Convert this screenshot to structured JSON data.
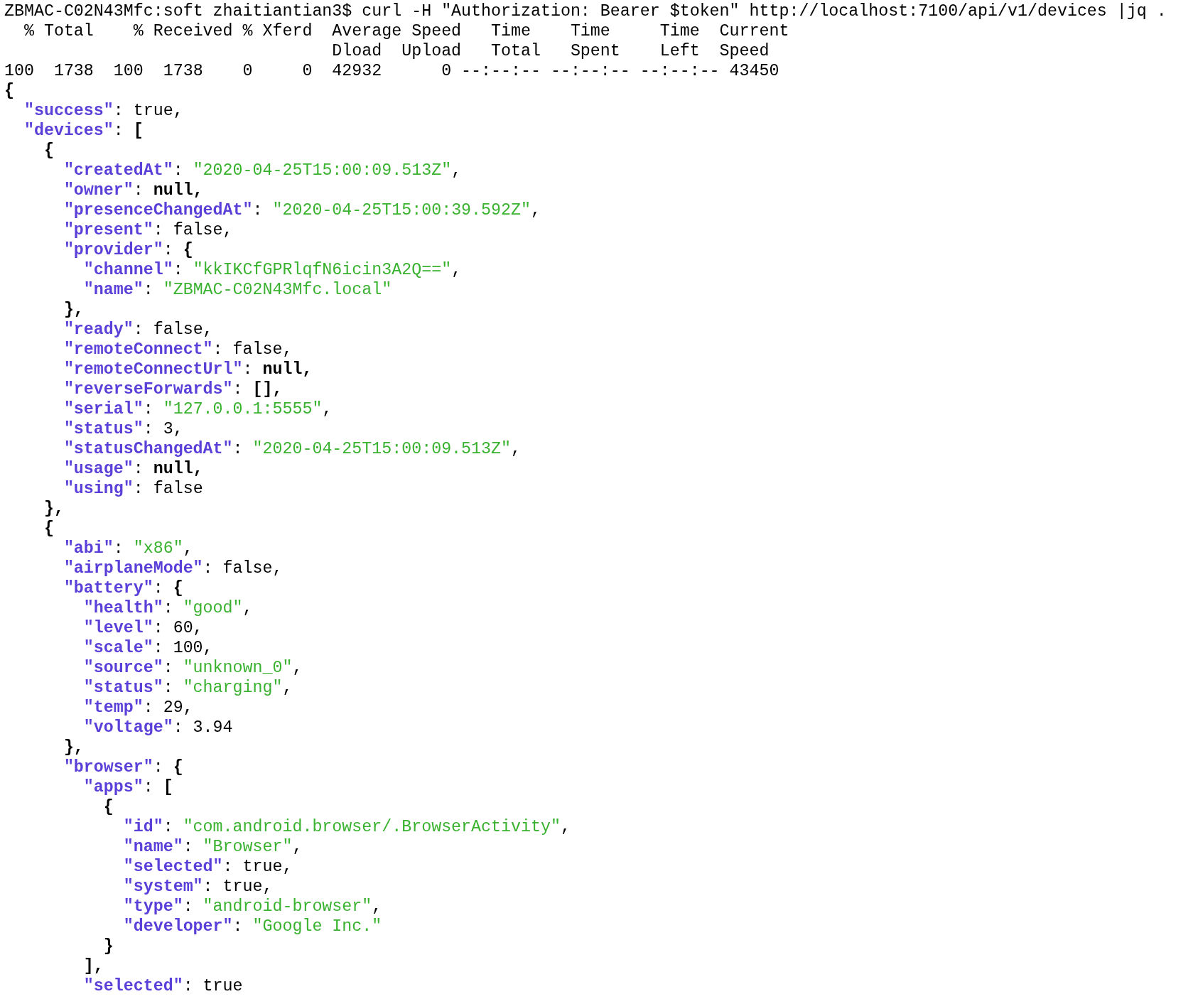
{
  "prompt": {
    "text": "ZBMAC-C02N43Mfc:soft zhaitiantian3$ curl -H \"Authorization: Bearer $token\" http://localhost:7100/api/v1/devices |jq ."
  },
  "curl_output": [
    "  % Total    % Received % Xferd  Average Speed   Time    Time     Time  Current",
    "                                 Dload  Upload   Total   Spent    Left  Speed",
    "100  1738  100  1738    0     0  42932      0 --:--:-- --:--:-- --:--:-- 43450"
  ],
  "json_output": [
    {
      "tokens": [
        {
          "kind": "bold",
          "text": "{"
        }
      ],
      "children": [
        {
          "tokens": [
            {
              "kind": "key",
              "text": "\"success\""
            },
            {
              "kind": "plain",
              "text": ": true,"
            }
          ]
        },
        {
          "tokens": [
            {
              "kind": "key",
              "text": "\"devices\""
            },
            {
              "kind": "plain",
              "text": ": "
            },
            {
              "kind": "bold",
              "text": "["
            }
          ],
          "children": [
            {
              "tokens": [
                {
                  "kind": "bold",
                  "text": "{"
                }
              ],
              "children": [
                {
                  "tokens": [
                    {
                      "kind": "key",
                      "text": "\"createdAt\""
                    },
                    {
                      "kind": "plain",
                      "text": ": "
                    },
                    {
                      "kind": "string",
                      "text": "\"2020-04-25T15:00:09.513Z\""
                    },
                    {
                      "kind": "plain",
                      "text": ","
                    }
                  ]
                },
                {
                  "tokens": [
                    {
                      "kind": "key",
                      "text": "\"owner\""
                    },
                    {
                      "kind": "plain",
                      "text": ": "
                    },
                    {
                      "kind": "bold",
                      "text": "null,"
                    }
                  ]
                },
                {
                  "tokens": [
                    {
                      "kind": "key",
                      "text": "\"presenceChangedAt\""
                    },
                    {
                      "kind": "plain",
                      "text": ": "
                    },
                    {
                      "kind": "string",
                      "text": "\"2020-04-25T15:00:39.592Z\""
                    },
                    {
                      "kind": "plain",
                      "text": ","
                    }
                  ]
                },
                {
                  "tokens": [
                    {
                      "kind": "key",
                      "text": "\"present\""
                    },
                    {
                      "kind": "plain",
                      "text": ": false,"
                    }
                  ]
                },
                {
                  "tokens": [
                    {
                      "kind": "key",
                      "text": "\"provider\""
                    },
                    {
                      "kind": "plain",
                      "text": ": "
                    },
                    {
                      "kind": "bold",
                      "text": "{"
                    }
                  ],
                  "children": [
                    {
                      "tokens": [
                        {
                          "kind": "key",
                          "text": "\"channel\""
                        },
                        {
                          "kind": "plain",
                          "text": ": "
                        },
                        {
                          "kind": "string",
                          "text": "\"kkIKCfGPRlqfN6icin3A2Q==\""
                        },
                        {
                          "kind": "plain",
                          "text": ","
                        }
                      ]
                    },
                    {
                      "tokens": [
                        {
                          "kind": "key",
                          "text": "\"name\""
                        },
                        {
                          "kind": "plain",
                          "text": ": "
                        },
                        {
                          "kind": "string",
                          "text": "\"ZBMAC-C02N43Mfc.local\""
                        }
                      ]
                    }
                  ]
                },
                {
                  "tokens": [
                    {
                      "kind": "bold",
                      "text": "},"
                    }
                  ]
                },
                {
                  "tokens": [
                    {
                      "kind": "key",
                      "text": "\"ready\""
                    },
                    {
                      "kind": "plain",
                      "text": ": false,"
                    }
                  ]
                },
                {
                  "tokens": [
                    {
                      "kind": "key",
                      "text": "\"remoteConnect\""
                    },
                    {
                      "kind": "plain",
                      "text": ": false,"
                    }
                  ]
                },
                {
                  "tokens": [
                    {
                      "kind": "key",
                      "text": "\"remoteConnectUrl\""
                    },
                    {
                      "kind": "plain",
                      "text": ": "
                    },
                    {
                      "kind": "bold",
                      "text": "null,"
                    }
                  ]
                },
                {
                  "tokens": [
                    {
                      "kind": "key",
                      "text": "\"reverseForwards\""
                    },
                    {
                      "kind": "plain",
                      "text": ": "
                    },
                    {
                      "kind": "bold",
                      "text": "[],"
                    }
                  ]
                },
                {
                  "tokens": [
                    {
                      "kind": "key",
                      "text": "\"serial\""
                    },
                    {
                      "kind": "plain",
                      "text": ": "
                    },
                    {
                      "kind": "string",
                      "text": "\"127.0.0.1:5555\""
                    },
                    {
                      "kind": "plain",
                      "text": ","
                    }
                  ]
                },
                {
                  "tokens": [
                    {
                      "kind": "key",
                      "text": "\"status\""
                    },
                    {
                      "kind": "plain",
                      "text": ": 3,"
                    }
                  ]
                },
                {
                  "tokens": [
                    {
                      "kind": "key",
                      "text": "\"statusChangedAt\""
                    },
                    {
                      "kind": "plain",
                      "text": ": "
                    },
                    {
                      "kind": "string",
                      "text": "\"2020-04-25T15:00:09.513Z\""
                    },
                    {
                      "kind": "plain",
                      "text": ","
                    }
                  ]
                },
                {
                  "tokens": [
                    {
                      "kind": "key",
                      "text": "\"usage\""
                    },
                    {
                      "kind": "plain",
                      "text": ": "
                    },
                    {
                      "kind": "bold",
                      "text": "null,"
                    }
                  ]
                },
                {
                  "tokens": [
                    {
                      "kind": "key",
                      "text": "\"using\""
                    },
                    {
                      "kind": "plain",
                      "text": ": false"
                    }
                  ]
                }
              ]
            },
            {
              "tokens": [
                {
                  "kind": "bold",
                  "text": "},"
                }
              ]
            },
            {
              "tokens": [
                {
                  "kind": "bold",
                  "text": "{"
                }
              ],
              "children": [
                {
                  "tokens": [
                    {
                      "kind": "key",
                      "text": "\"abi\""
                    },
                    {
                      "kind": "plain",
                      "text": ": "
                    },
                    {
                      "kind": "string",
                      "text": "\"x86\""
                    },
                    {
                      "kind": "plain",
                      "text": ","
                    }
                  ]
                },
                {
                  "tokens": [
                    {
                      "kind": "key",
                      "text": "\"airplaneMode\""
                    },
                    {
                      "kind": "plain",
                      "text": ": false,"
                    }
                  ]
                },
                {
                  "tokens": [
                    {
                      "kind": "key",
                      "text": "\"battery\""
                    },
                    {
                      "kind": "plain",
                      "text": ": "
                    },
                    {
                      "kind": "bold",
                      "text": "{"
                    }
                  ],
                  "children": [
                    {
                      "tokens": [
                        {
                          "kind": "key",
                          "text": "\"health\""
                        },
                        {
                          "kind": "plain",
                          "text": ": "
                        },
                        {
                          "kind": "string",
                          "text": "\"good\""
                        },
                        {
                          "kind": "plain",
                          "text": ","
                        }
                      ]
                    },
                    {
                      "tokens": [
                        {
                          "kind": "key",
                          "text": "\"level\""
                        },
                        {
                          "kind": "plain",
                          "text": ": 60,"
                        }
                      ]
                    },
                    {
                      "tokens": [
                        {
                          "kind": "key",
                          "text": "\"scale\""
                        },
                        {
                          "kind": "plain",
                          "text": ": 100,"
                        }
                      ]
                    },
                    {
                      "tokens": [
                        {
                          "kind": "key",
                          "text": "\"source\""
                        },
                        {
                          "kind": "plain",
                          "text": ": "
                        },
                        {
                          "kind": "string",
                          "text": "\"unknown_0\""
                        },
                        {
                          "kind": "plain",
                          "text": ","
                        }
                      ]
                    },
                    {
                      "tokens": [
                        {
                          "kind": "key",
                          "text": "\"status\""
                        },
                        {
                          "kind": "plain",
                          "text": ": "
                        },
                        {
                          "kind": "string",
                          "text": "\"charging\""
                        },
                        {
                          "kind": "plain",
                          "text": ","
                        }
                      ]
                    },
                    {
                      "tokens": [
                        {
                          "kind": "key",
                          "text": "\"temp\""
                        },
                        {
                          "kind": "plain",
                          "text": ": 29,"
                        }
                      ]
                    },
                    {
                      "tokens": [
                        {
                          "kind": "key",
                          "text": "\"voltage\""
                        },
                        {
                          "kind": "plain",
                          "text": ": 3.94"
                        }
                      ]
                    }
                  ]
                },
                {
                  "tokens": [
                    {
                      "kind": "bold",
                      "text": "},"
                    }
                  ]
                },
                {
                  "tokens": [
                    {
                      "kind": "key",
                      "text": "\"browser\""
                    },
                    {
                      "kind": "plain",
                      "text": ": "
                    },
                    {
                      "kind": "bold",
                      "text": "{"
                    }
                  ],
                  "children": [
                    {
                      "tokens": [
                        {
                          "kind": "key",
                          "text": "\"apps\""
                        },
                        {
                          "kind": "plain",
                          "text": ": "
                        },
                        {
                          "kind": "bold",
                          "text": "["
                        }
                      ],
                      "children": [
                        {
                          "tokens": [
                            {
                              "kind": "bold",
                              "text": "{"
                            }
                          ],
                          "children": [
                            {
                              "tokens": [
                                {
                                  "kind": "key",
                                  "text": "\"id\""
                                },
                                {
                                  "kind": "plain",
                                  "text": ": "
                                },
                                {
                                  "kind": "string",
                                  "text": "\"com.android.browser/.BrowserActivity\""
                                },
                                {
                                  "kind": "plain",
                                  "text": ","
                                }
                              ]
                            },
                            {
                              "tokens": [
                                {
                                  "kind": "key",
                                  "text": "\"name\""
                                },
                                {
                                  "kind": "plain",
                                  "text": ": "
                                },
                                {
                                  "kind": "string",
                                  "text": "\"Browser\""
                                },
                                {
                                  "kind": "plain",
                                  "text": ","
                                }
                              ]
                            },
                            {
                              "tokens": [
                                {
                                  "kind": "key",
                                  "text": "\"selected\""
                                },
                                {
                                  "kind": "plain",
                                  "text": ": true,"
                                }
                              ]
                            },
                            {
                              "tokens": [
                                {
                                  "kind": "key",
                                  "text": "\"system\""
                                },
                                {
                                  "kind": "plain",
                                  "text": ": true,"
                                }
                              ]
                            },
                            {
                              "tokens": [
                                {
                                  "kind": "key",
                                  "text": "\"type\""
                                },
                                {
                                  "kind": "plain",
                                  "text": ": "
                                },
                                {
                                  "kind": "string",
                                  "text": "\"android-browser\""
                                },
                                {
                                  "kind": "plain",
                                  "text": ","
                                }
                              ]
                            },
                            {
                              "tokens": [
                                {
                                  "kind": "key",
                                  "text": "\"developer\""
                                },
                                {
                                  "kind": "plain",
                                  "text": ": "
                                },
                                {
                                  "kind": "string",
                                  "text": "\"Google Inc.\""
                                }
                              ]
                            }
                          ]
                        },
                        {
                          "tokens": [
                            {
                              "kind": "bold",
                              "text": "}"
                            }
                          ]
                        }
                      ]
                    },
                    {
                      "tokens": [
                        {
                          "kind": "bold",
                          "text": "],"
                        }
                      ]
                    },
                    {
                      "tokens": [
                        {
                          "kind": "key",
                          "text": "\"selected\""
                        },
                        {
                          "kind": "plain",
                          "text": ": true"
                        }
                      ]
                    }
                  ]
                }
              ]
            }
          ]
        }
      ]
    }
  ]
}
